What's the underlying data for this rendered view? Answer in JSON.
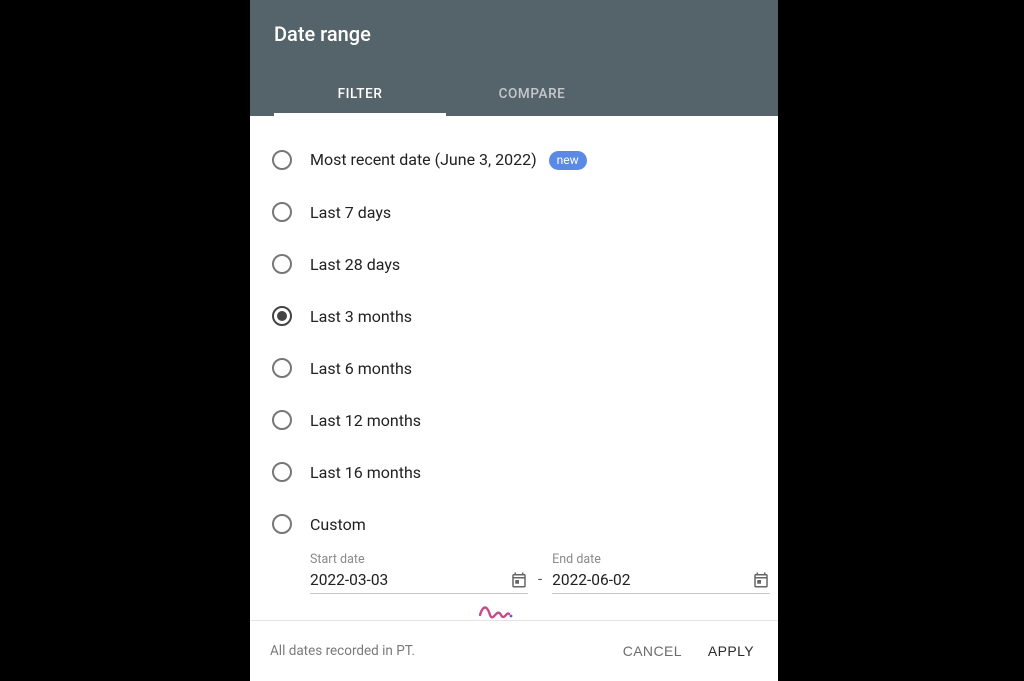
{
  "header": {
    "title": "Date range",
    "tabs": [
      {
        "label": "FILTER",
        "active": true
      },
      {
        "label": "COMPARE",
        "active": false
      }
    ]
  },
  "options": [
    {
      "id": "most-recent",
      "label": "Most recent date (June 3, 2022)",
      "selected": false,
      "badge": "new"
    },
    {
      "id": "last-7",
      "label": "Last 7 days",
      "selected": false
    },
    {
      "id": "last-28",
      "label": "Last 28 days",
      "selected": false
    },
    {
      "id": "last-3m",
      "label": "Last 3 months",
      "selected": true
    },
    {
      "id": "last-6m",
      "label": "Last 6 months",
      "selected": false
    },
    {
      "id": "last-12m",
      "label": "Last 12 months",
      "selected": false
    },
    {
      "id": "last-16m",
      "label": "Last 16 months",
      "selected": false
    },
    {
      "id": "custom",
      "label": "Custom",
      "selected": false
    }
  ],
  "dateFields": {
    "start": {
      "label": "Start date",
      "value": "2022-03-03"
    },
    "end": {
      "label": "End date",
      "value": "2022-06-02"
    },
    "separator": "-"
  },
  "footer": {
    "note": "All dates recorded in PT.",
    "cancel": "CANCEL",
    "apply": "APPLY"
  }
}
